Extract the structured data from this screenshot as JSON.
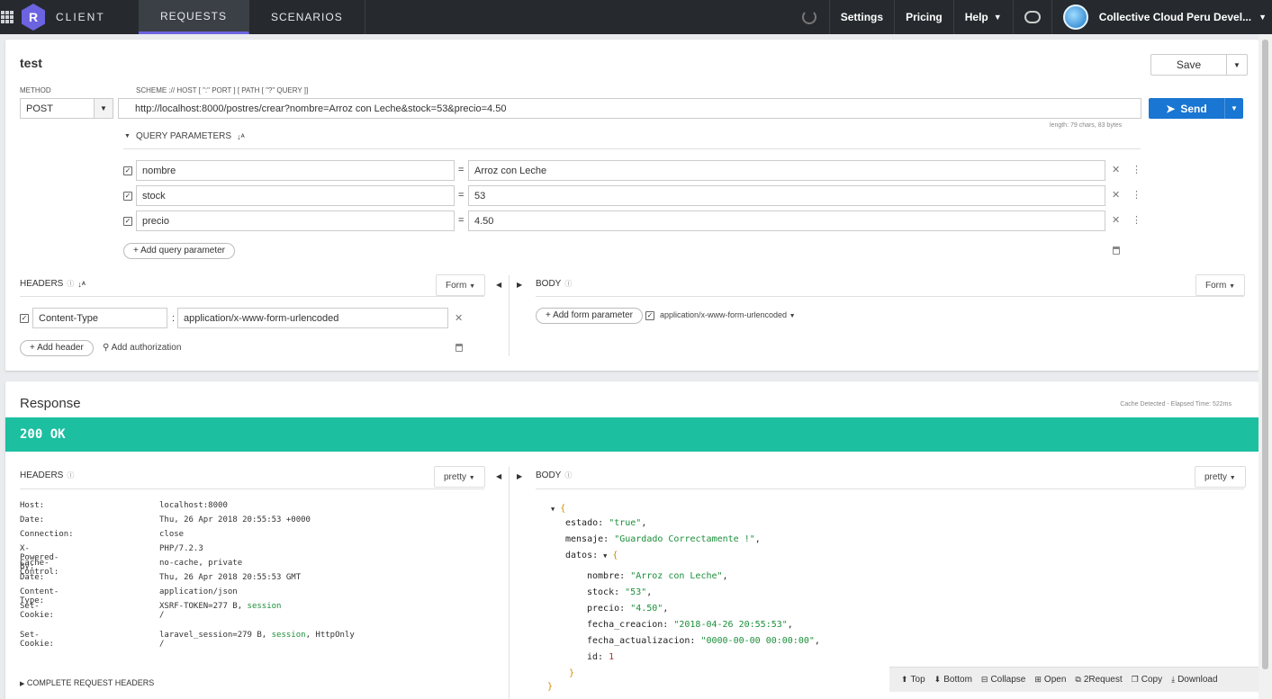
{
  "topbar": {
    "brand": "CLIENT",
    "logo_letter": "R",
    "tabs": [
      "REQUESTS",
      "SCENARIOS"
    ],
    "settings": "Settings",
    "pricing": "Pricing",
    "help": "Help",
    "account": "Collective Cloud Peru Devel..."
  },
  "request": {
    "title": "test",
    "save": "Save",
    "method_label": "METHOD",
    "method": "POST",
    "scheme_label": "SCHEME :// HOST [ \":\" PORT ] [ PATH [ \"?\" QUERY ]]",
    "url": "http://localhost:8000/postres/crear?nombre=Arroz con Leche&stock=53&precio=4.50",
    "send": "Send",
    "length": "length: 79 chars, 83 bytes",
    "query_header": "QUERY PARAMETERS",
    "params": [
      {
        "name": "nombre",
        "value": "Arroz con Leche"
      },
      {
        "name": "stock",
        "value": "53"
      },
      {
        "name": "precio",
        "value": "4.50"
      }
    ],
    "add_query": "+ Add query parameter",
    "headers_label": "HEADERS",
    "form": "Form",
    "body_label": "BODY",
    "header_rows": [
      {
        "name": "Content-Type",
        "value": "application/x-www-form-urlencoded"
      }
    ],
    "add_header": "+ Add header",
    "add_auth": "Add authorization",
    "add_form_param": "+ Add form parameter",
    "body_type": "application/x-www-form-urlencoded"
  },
  "response": {
    "title": "Response",
    "cache": "Cache Detected - Elapsed Time: 522ms",
    "status": "200 OK",
    "headers_label": "HEADERS",
    "body_label": "BODY",
    "pretty": "pretty",
    "headers": [
      {
        "k": "Host:",
        "v": "localhost:8000"
      },
      {
        "k": "Date:",
        "v": "Thu, 26 Apr 2018 20:55:53 +0000"
      },
      {
        "k": "Connection:",
        "v": "close"
      },
      {
        "k": "X-Powered-By:",
        "v": "PHP/7.2.3"
      },
      {
        "k": "Cache-Control:",
        "v": "no-cache, private"
      },
      {
        "k": "Date:",
        "v": "Thu, 26 Apr 2018 20:55:53 GMT"
      },
      {
        "k": "Content-Type:",
        "v": "application/json"
      },
      {
        "k": "Set-Cookie:",
        "v1": "XSRF-TOKEN=277 B, ",
        "v2": "session",
        "v3": "/"
      },
      {
        "k": "Set-Cookie:",
        "v1": "laravel_session=279 B, ",
        "v2": "session",
        "v2b": ", HttpOnly",
        "v3": "/"
      }
    ],
    "complete": "COMPLETE REQUEST HEADERS",
    "json": {
      "estado": "\"true\"",
      "mensaje": "\"Guardado Correctamente !\"",
      "nombre": "\"Arroz con Leche\"",
      "stock": "\"53\"",
      "precio": "\"4.50\"",
      "fecha_creacion": "\"2018-04-26 20:55:53\"",
      "fecha_actualizacion": "\"0000-00-00 00:00:00\"",
      "id": "1"
    },
    "json_keys": {
      "estado": "estado:",
      "mensaje": "mensaje:",
      "datos": "datos:",
      "nombre": "nombre:",
      "stock": "stock:",
      "precio": "precio:",
      "fecha_creacion": "fecha_creacion:",
      "fecha_actualizacion": "fecha_actualizacion:",
      "id": "id:"
    }
  },
  "footer": {
    "top": "Top",
    "bottom": "Bottom",
    "collapse": "Collapse",
    "open": "Open",
    "request": "2Request",
    "copy": "Copy",
    "download": "Download"
  },
  "colors": {
    "accent": "#6c63e0",
    "send": "#1976d2",
    "status_ok": "#1cbfa0"
  }
}
